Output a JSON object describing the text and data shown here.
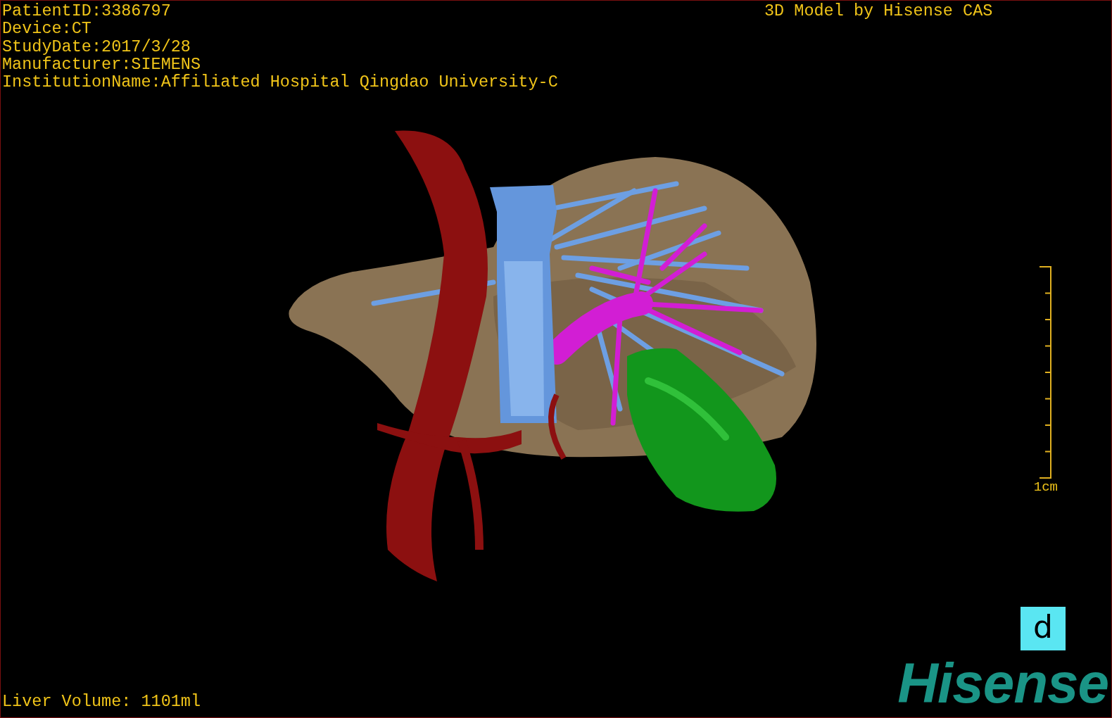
{
  "info_lines": [
    "PatientID:3386797",
    "Device:CT",
    "StudyDate:2017/3/28",
    "Manufacturer:SIEMENS",
    "InstitutionName:Affiliated Hospital Qingdao University-C"
  ],
  "title": "3D Model by Hisense CAS",
  "scale_bar": {
    "label": "1cm"
  },
  "orientation_cube": {
    "label": "d"
  },
  "liver_volume": "Liver Volume: 1101ml",
  "logo": "Hisense"
}
